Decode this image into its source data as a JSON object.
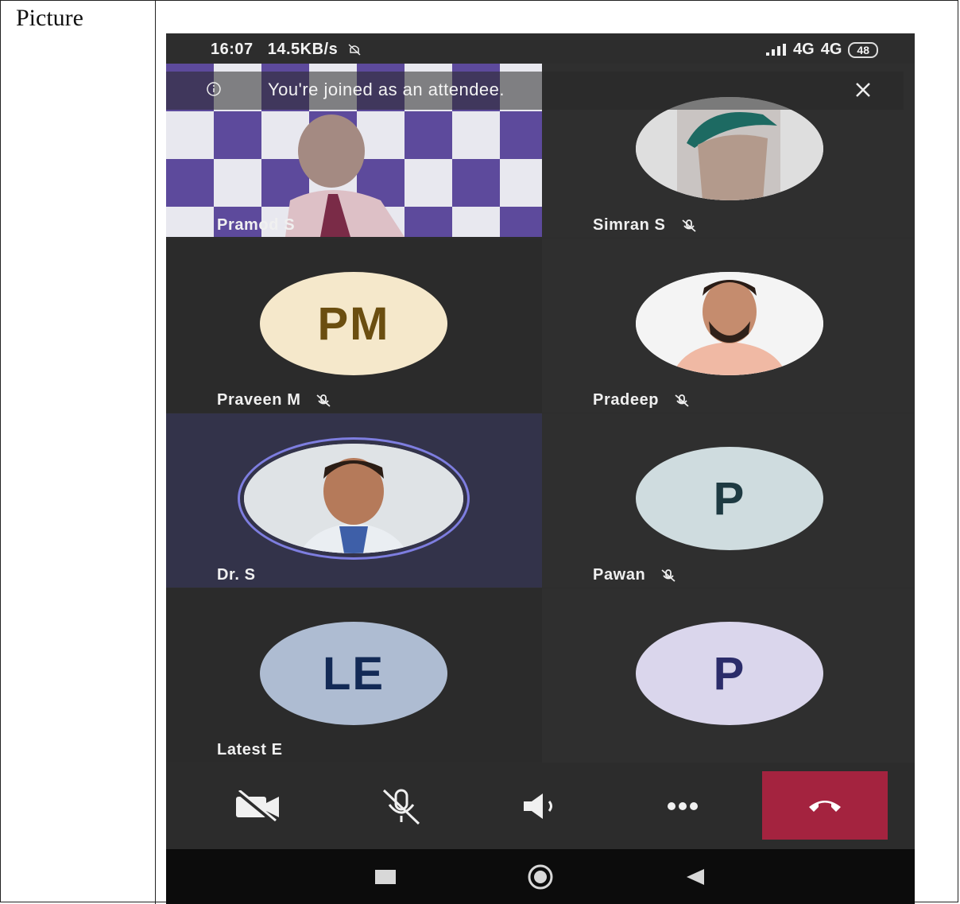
{
  "document": {
    "row_label": "Picture"
  },
  "status_bar": {
    "time": "16:07",
    "net_speed": "14.5KB/s",
    "signal_1": "4G",
    "signal_2": "4G",
    "battery": "48"
  },
  "banner": {
    "text": "You're joined as an attendee.",
    "info_icon": "info-icon",
    "close_icon": "close-icon"
  },
  "participants": [
    {
      "name": "Pramod S",
      "kind": "video",
      "muted": false
    },
    {
      "name": "Simran S",
      "kind": "photo",
      "muted": true
    },
    {
      "name": "Praveen M",
      "initials": "PM",
      "kind": "initials",
      "muted": true
    },
    {
      "name": "Pradeep",
      "kind": "photo",
      "muted": true
    },
    {
      "name": "Dr. S",
      "kind": "photo",
      "muted": false,
      "speaking": true
    },
    {
      "name": "Pawan",
      "initials": "P",
      "kind": "initials",
      "muted": true
    },
    {
      "name": "Latest E",
      "initials": "LE",
      "kind": "initials",
      "muted": false
    },
    {
      "name": "",
      "initials": "P",
      "kind": "initials",
      "muted": false
    }
  ],
  "controls": {
    "camera": "camera-off-icon",
    "mic": "mic-off-icon",
    "speaker": "speaker-icon",
    "more": "more-icon",
    "hangup": "hang-up-icon",
    "hangup_color": "#a4233f"
  },
  "navbar": {
    "recents": "square-icon",
    "home": "circle-icon",
    "back": "triangle-back-icon"
  }
}
